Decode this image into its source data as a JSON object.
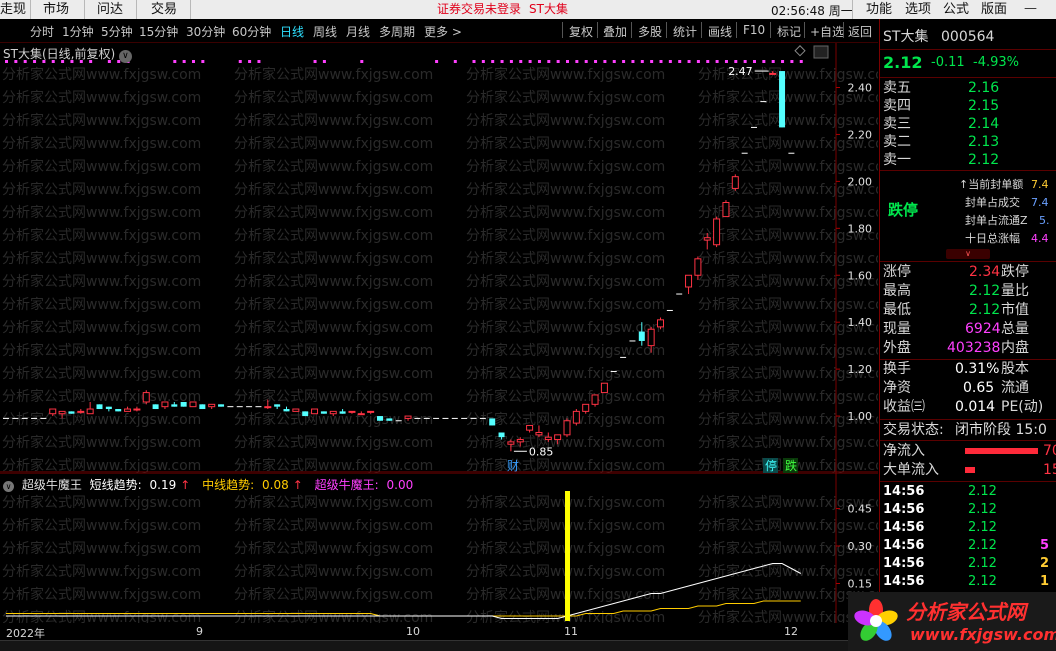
{
  "menubar": {
    "items": [
      "走现",
      "市场",
      "问达",
      "交易"
    ],
    "notice": "证券交易未登录",
    "stock_name": "ST大集",
    "clock": "02:56:48 周一",
    "right_items": [
      "功能",
      "选项",
      "公式",
      "版面"
    ]
  },
  "toolbar": {
    "periods": [
      "分时",
      "1分钟",
      "5分钟",
      "15分钟",
      "30分钟",
      "60分钟",
      "日线",
      "周线",
      "月线",
      "多周期",
      "更多 >"
    ],
    "active_period": "日线",
    "tools": [
      "复权",
      "叠加",
      "多股",
      "统计",
      "画线",
      "F10",
      "标记",
      "+自选",
      "返回"
    ]
  },
  "chart_title": "ST大集(日线,前复权)",
  "chart_data": {
    "type": "candlestick",
    "title": "ST大集(日线,前复权)",
    "y_ticks": [
      1.0,
      1.2,
      1.4,
      1.6,
      1.8,
      2.0,
      2.2,
      2.4
    ],
    "ylim": [
      0.8,
      2.53
    ],
    "x_ticks": [
      "2022年",
      "9",
      "10",
      "11",
      "12"
    ],
    "annotations": {
      "low_label": "0.85",
      "high_label": "2.47",
      "marker_cai": "财",
      "marker_ting": "停",
      "marker_die": "跌"
    },
    "candles": [
      {
        "o": 0.99,
        "h": 0.99,
        "l": 0.99,
        "c": 0.99
      },
      {
        "o": 0.99,
        "h": 0.99,
        "l": 0.99,
        "c": 0.99
      },
      {
        "o": 0.99,
        "h": 0.99,
        "l": 0.99,
        "c": 0.99
      },
      {
        "o": 0.99,
        "h": 0.99,
        "l": 0.99,
        "c": 0.99
      },
      {
        "o": 0.99,
        "h": 0.99,
        "l": 0.99,
        "c": 0.99
      },
      {
        "o": 1.01,
        "h": 1.03,
        "l": 1.0,
        "c": 1.03
      },
      {
        "o": 1.01,
        "h": 1.02,
        "l": 0.99,
        "c": 1.02
      },
      {
        "o": 1.02,
        "h": 1.02,
        "l": 1.01,
        "c": 1.01
      },
      {
        "o": 1.02,
        "h": 1.03,
        "l": 1.01,
        "c": 1.02
      },
      {
        "o": 1.01,
        "h": 1.06,
        "l": 1.01,
        "c": 1.03
      },
      {
        "o": 1.05,
        "h": 1.05,
        "l": 1.03,
        "c": 1.03
      },
      {
        "o": 1.04,
        "h": 1.04,
        "l": 1.02,
        "c": 1.03
      },
      {
        "o": 1.03,
        "h": 1.03,
        "l": 1.02,
        "c": 1.02
      },
      {
        "o": 1.02,
        "h": 1.04,
        "l": 1.02,
        "c": 1.03
      },
      {
        "o": 1.03,
        "h": 1.04,
        "l": 1.02,
        "c": 1.03
      },
      {
        "o": 1.06,
        "h": 1.11,
        "l": 1.05,
        "c": 1.1
      },
      {
        "o": 1.05,
        "h": 1.05,
        "l": 1.03,
        "c": 1.03
      },
      {
        "o": 1.04,
        "h": 1.06,
        "l": 1.03,
        "c": 1.06
      },
      {
        "o": 1.05,
        "h": 1.06,
        "l": 1.04,
        "c": 1.04
      },
      {
        "o": 1.06,
        "h": 1.06,
        "l": 1.04,
        "c": 1.04
      },
      {
        "o": 1.04,
        "h": 1.06,
        "l": 1.04,
        "c": 1.06
      },
      {
        "o": 1.05,
        "h": 1.05,
        "l": 1.03,
        "c": 1.03
      },
      {
        "o": 1.04,
        "h": 1.05,
        "l": 1.03,
        "c": 1.05
      },
      {
        "o": 1.05,
        "h": 1.05,
        "l": 1.04,
        "c": 1.04
      },
      {
        "o": 1.04,
        "h": 1.04,
        "l": 1.04,
        "c": 1.04
      },
      {
        "o": 1.04,
        "h": 1.04,
        "l": 1.04,
        "c": 1.04
      },
      {
        "o": 1.04,
        "h": 1.04,
        "l": 1.04,
        "c": 1.04
      },
      {
        "o": 1.04,
        "h": 1.04,
        "l": 1.04,
        "c": 1.04
      },
      {
        "o": 1.04,
        "h": 1.07,
        "l": 1.03,
        "c": 1.04
      },
      {
        "o": 1.05,
        "h": 1.05,
        "l": 1.03,
        "c": 1.04
      },
      {
        "o": 1.03,
        "h": 1.04,
        "l": 1.02,
        "c": 1.02
      },
      {
        "o": 1.02,
        "h": 1.03,
        "l": 1.02,
        "c": 1.03
      },
      {
        "o": 1.02,
        "h": 1.02,
        "l": 1.0,
        "c": 1.0
      },
      {
        "o": 1.01,
        "h": 1.03,
        "l": 1.01,
        "c": 1.03
      },
      {
        "o": 1.02,
        "h": 1.02,
        "l": 1.01,
        "c": 1.01
      },
      {
        "o": 1.01,
        "h": 1.02,
        "l": 1.0,
        "c": 1.02
      },
      {
        "o": 1.02,
        "h": 1.03,
        "l": 1.01,
        "c": 1.01
      },
      {
        "o": 1.02,
        "h": 1.02,
        "l": 1.01,
        "c": 1.02
      },
      {
        "o": 1.01,
        "h": 1.02,
        "l": 1.01,
        "c": 1.01
      },
      {
        "o": 1.02,
        "h": 1.02,
        "l": 1.01,
        "c": 1.02
      },
      {
        "o": 1.0,
        "h": 1.0,
        "l": 0.98,
        "c": 0.98
      },
      {
        "o": 0.99,
        "h": 0.99,
        "l": 0.98,
        "c": 0.98
      },
      {
        "o": 0.98,
        "h": 0.98,
        "l": 0.98,
        "c": 0.98
      },
      {
        "o": 0.99,
        "h": 1.0,
        "l": 0.98,
        "c": 1.0
      },
      {
        "o": 0.99,
        "h": 0.99,
        "l": 0.99,
        "c": 0.99
      },
      {
        "o": 0.99,
        "h": 0.99,
        "l": 0.99,
        "c": 0.99
      },
      {
        "o": 0.99,
        "h": 0.99,
        "l": 0.99,
        "c": 0.99
      },
      {
        "o": 0.99,
        "h": 0.99,
        "l": 0.99,
        "c": 0.99
      },
      {
        "o": 0.99,
        "h": 0.99,
        "l": 0.99,
        "c": 0.99
      },
      {
        "o": 0.99,
        "h": 0.99,
        "l": 0.99,
        "c": 0.99
      },
      {
        "o": 0.99,
        "h": 0.99,
        "l": 0.99,
        "c": 0.99
      },
      {
        "o": 0.99,
        "h": 0.99,
        "l": 0.99,
        "c": 0.99
      },
      {
        "o": 0.99,
        "h": 0.99,
        "l": 0.96,
        "c": 0.96
      },
      {
        "o": 0.93,
        "h": 0.93,
        "l": 0.9,
        "c": 0.91
      },
      {
        "o": 0.88,
        "h": 0.9,
        "l": 0.85,
        "c": 0.89
      },
      {
        "o": 0.89,
        "h": 0.91,
        "l": 0.87,
        "c": 0.9
      },
      {
        "o": 0.94,
        "h": 0.96,
        "l": 0.93,
        "c": 0.96
      },
      {
        "o": 0.92,
        "h": 0.96,
        "l": 0.91,
        "c": 0.93
      },
      {
        "o": 0.9,
        "h": 0.93,
        "l": 0.89,
        "c": 0.91
      },
      {
        "o": 0.9,
        "h": 0.92,
        "l": 0.88,
        "c": 0.92
      },
      {
        "o": 0.92,
        "h": 0.99,
        "l": 0.91,
        "c": 0.98
      },
      {
        "o": 0.97,
        "h": 1.03,
        "l": 0.96,
        "c": 1.02
      },
      {
        "o": 1.02,
        "h": 1.05,
        "l": 1.01,
        "c": 1.05
      },
      {
        "o": 1.05,
        "h": 1.09,
        "l": 1.04,
        "c": 1.09
      },
      {
        "o": 1.1,
        "h": 1.14,
        "l": 1.1,
        "c": 1.14
      },
      {
        "o": 1.19,
        "h": 1.19,
        "l": 1.19,
        "c": 1.19
      },
      {
        "o": 1.25,
        "h": 1.25,
        "l": 1.25,
        "c": 1.25
      },
      {
        "o": 1.32,
        "h": 1.32,
        "l": 1.32,
        "c": 1.32
      },
      {
        "o": 1.36,
        "h": 1.4,
        "l": 1.3,
        "c": 1.32
      },
      {
        "o": 1.3,
        "h": 1.38,
        "l": 1.27,
        "c": 1.37
      },
      {
        "o": 1.38,
        "h": 1.42,
        "l": 1.37,
        "c": 1.41
      },
      {
        "o": 1.45,
        "h": 1.45,
        "l": 1.45,
        "c": 1.45
      },
      {
        "o": 1.52,
        "h": 1.52,
        "l": 1.52,
        "c": 1.52
      },
      {
        "o": 1.55,
        "h": 1.6,
        "l": 1.52,
        "c": 1.6
      },
      {
        "o": 1.6,
        "h": 1.68,
        "l": 1.58,
        "c": 1.67
      },
      {
        "o": 1.75,
        "h": 1.78,
        "l": 1.71,
        "c": 1.76
      },
      {
        "o": 1.73,
        "h": 1.85,
        "l": 1.72,
        "c": 1.84
      },
      {
        "o": 1.85,
        "h": 1.92,
        "l": 1.85,
        "c": 1.91
      },
      {
        "o": 1.97,
        "h": 2.03,
        "l": 1.96,
        "c": 2.02
      },
      {
        "o": 2.12,
        "h": 2.12,
        "l": 2.12,
        "c": 2.12
      },
      {
        "o": 2.23,
        "h": 2.23,
        "l": 2.23,
        "c": 2.23
      },
      {
        "o": 2.34,
        "h": 2.34,
        "l": 2.34,
        "c": 2.34
      },
      {
        "o": 2.46,
        "h": 2.47,
        "l": 2.46,
        "c": 2.46
      },
      {
        "o": 2.47,
        "h": 2.47,
        "l": 2.23,
        "c": 2.23
      },
      {
        "o": 2.12,
        "h": 2.12,
        "l": 2.12,
        "c": 2.12
      }
    ],
    "top_markers": [
      0,
      1,
      2,
      3,
      4,
      5,
      6,
      7,
      8,
      9,
      11,
      12,
      13,
      18,
      19,
      20,
      21,
      25,
      26,
      27,
      33,
      34,
      38,
      46,
      48,
      50,
      51,
      52,
      53,
      54,
      55,
      56,
      57,
      58,
      59,
      60,
      61,
      62,
      63,
      64,
      65,
      66,
      67,
      68,
      69,
      70,
      71,
      72,
      73,
      74,
      75,
      76,
      77,
      78,
      79,
      80,
      81,
      82,
      83,
      84,
      85
    ]
  },
  "indicator": {
    "name": "超级牛魔王",
    "short_label": "短线趋势:",
    "short_value": "0.19",
    "mid_label": "中线趋势:",
    "mid_value": "0.08",
    "king_label": "超级牛魔王:",
    "king_value": "0.00",
    "y_ticks": [
      0.15,
      0.3,
      0.45
    ],
    "ylim": [
      0.0,
      0.56
    ],
    "short_series": [
      0.02,
      0.02,
      0.02,
      0.02,
      0.02,
      0.02,
      0.02,
      0.02,
      0.02,
      0.02,
      0.02,
      0.02,
      0.02,
      0.02,
      0.02,
      0.02,
      0.02,
      0.02,
      0.02,
      0.02,
      0.02,
      0.02,
      0.02,
      0.02,
      0.02,
      0.02,
      0.02,
      0.02,
      0.02,
      0.02,
      0.02,
      0.02,
      0.02,
      0.02,
      0.02,
      0.02,
      0.02,
      0.02,
      0.02,
      0.02,
      0.02,
      0.02,
      0.02,
      0.02,
      0.02,
      0.02,
      0.02,
      0.02,
      0.02,
      0.02,
      0.02,
      0.02,
      0.02,
      0.01,
      0.01,
      0.01,
      0.01,
      0.01,
      0.01,
      0.01,
      0.02,
      0.03,
      0.04,
      0.05,
      0.06,
      0.07,
      0.08,
      0.09,
      0.1,
      0.11,
      0.11,
      0.12,
      0.13,
      0.14,
      0.15,
      0.16,
      0.17,
      0.18,
      0.19,
      0.2,
      0.21,
      0.22,
      0.23,
      0.23,
      0.21,
      0.19
    ],
    "mid_series": [
      0.03,
      0.03,
      0.03,
      0.03,
      0.03,
      0.03,
      0.03,
      0.03,
      0.03,
      0.03,
      0.03,
      0.03,
      0.03,
      0.03,
      0.03,
      0.03,
      0.03,
      0.03,
      0.03,
      0.03,
      0.03,
      0.03,
      0.03,
      0.03,
      0.03,
      0.03,
      0.03,
      0.03,
      0.03,
      0.03,
      0.03,
      0.03,
      0.03,
      0.03,
      0.03,
      0.03,
      0.03,
      0.03,
      0.03,
      0.03,
      0.02,
      0.02,
      0.02,
      0.02,
      0.02,
      0.02,
      0.02,
      0.02,
      0.02,
      0.02,
      0.02,
      0.02,
      0.02,
      0.02,
      0.02,
      0.02,
      0.02,
      0.02,
      0.02,
      0.02,
      0.02,
      0.02,
      0.03,
      0.03,
      0.03,
      0.03,
      0.04,
      0.04,
      0.04,
      0.04,
      0.05,
      0.05,
      0.05,
      0.05,
      0.06,
      0.06,
      0.06,
      0.07,
      0.07,
      0.07,
      0.07,
      0.08,
      0.08,
      0.08,
      0.08,
      0.08
    ],
    "spike_index": 60,
    "spike_value": 0.52
  },
  "quote": {
    "name": "ST大集",
    "code": "000564",
    "price": "2.12",
    "change": "-0.11",
    "change_pct": "-4.93%",
    "asks": [
      {
        "label": "卖五",
        "price": "2.16"
      },
      {
        "label": "卖四",
        "price": "2.15"
      },
      {
        "label": "卖三",
        "price": "2.14"
      },
      {
        "label": "卖二",
        "price": "2.13"
      },
      {
        "label": "卖一",
        "price": "2.12"
      }
    ],
    "limit_state": "跌停",
    "seal_items": [
      {
        "label": "↑当前封单额",
        "value": "7.4"
      },
      {
        "label": "封单占成交",
        "value": "7.4"
      },
      {
        "label": "封单占流通Z",
        "value": "5."
      },
      {
        "label": "十日总涨幅",
        "value": "4.4"
      }
    ],
    "stats": [
      {
        "l1": "涨停",
        "v1": "2.34",
        "l2": "跌停"
      },
      {
        "l1": "最高",
        "v1": "2.12",
        "l2": "量比"
      },
      {
        "l1": "最低",
        "v1": "2.12",
        "l2": "市值"
      },
      {
        "l1": "现量",
        "v1": "6924",
        "l2": "总量"
      },
      {
        "l1": "外盘",
        "v1": "403238",
        "l2": "内盘"
      }
    ],
    "stats2": [
      {
        "l1": "换手",
        "v1": "0.31%",
        "l2": "股本"
      },
      {
        "l1": "净资",
        "v1": "0.65",
        "l2": "流通"
      },
      {
        "l1": "收益㈢",
        "v1": "0.014",
        "l2": "PE(动)"
      }
    ],
    "trade_state_label": "交易状态:",
    "trade_state": "闭市阶段 15:0",
    "flows": [
      {
        "label": "净流入",
        "value": "70"
      },
      {
        "label": "大单流入",
        "value": "15"
      }
    ],
    "ticks": [
      {
        "time": "14:56",
        "price": "2.12",
        "vol": ""
      },
      {
        "time": "14:56",
        "price": "2.12",
        "vol": ""
      },
      {
        "time": "14:56",
        "price": "2.12",
        "vol": ""
      },
      {
        "time": "14:56",
        "price": "2.12",
        "vol": "5"
      },
      {
        "time": "14:56",
        "price": "2.12",
        "vol": "2"
      },
      {
        "time": "14:56",
        "price": "2.12",
        "vol": "1"
      }
    ]
  },
  "watermark": "分析家公式网www.fxjgsw.com",
  "logo": {
    "text": "分析家公式网",
    "url": "www.fxjgsw.com"
  },
  "colors": {
    "up": "#ff3344",
    "down": "#54ffff",
    "short_line": "#ffffff",
    "mid_line": "#ffcc00",
    "spike": "#ffff00",
    "marker": "#ff40ff"
  }
}
